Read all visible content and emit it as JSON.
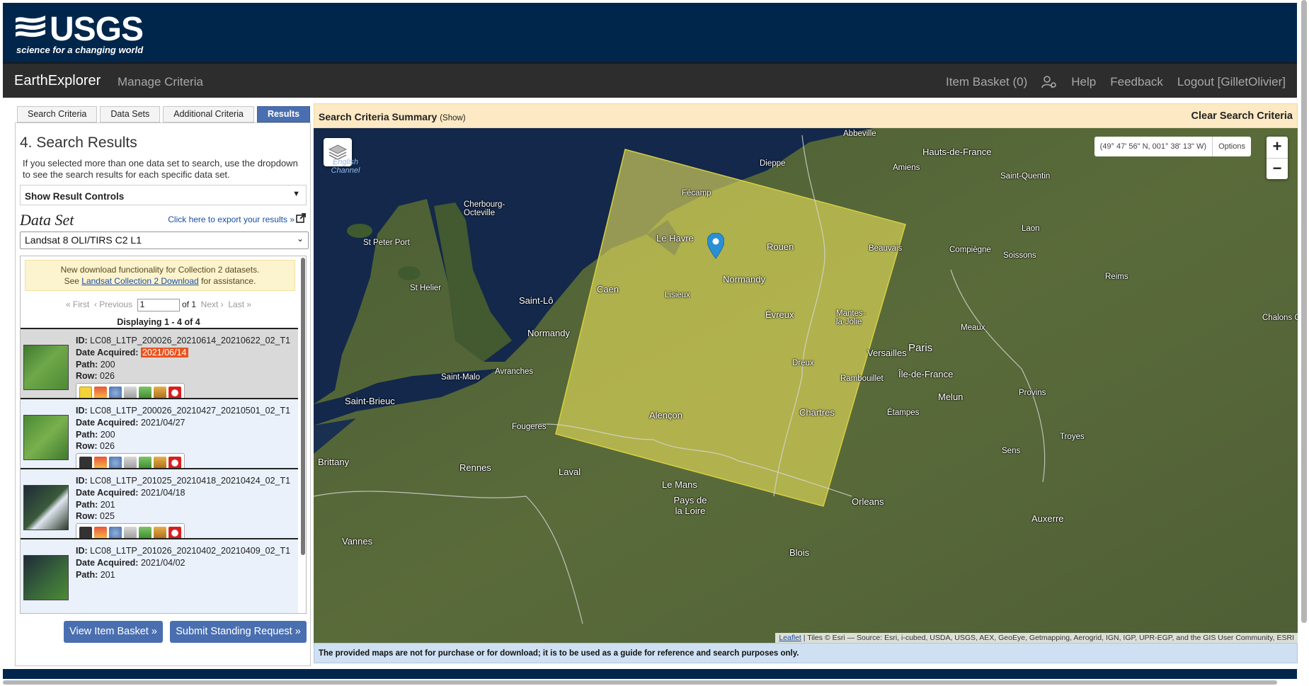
{
  "header": {
    "logo_text": "USGS",
    "logo_tagline": "science for a changing world"
  },
  "nav": {
    "brand": "EarthExplorer",
    "manage_criteria": "Manage Criteria",
    "item_basket": "Item Basket (0)",
    "help": "Help",
    "feedback": "Feedback",
    "logout": "Logout [GilletOlivier]"
  },
  "tabs": [
    "Search Criteria",
    "Data Sets",
    "Additional Criteria",
    "Results"
  ],
  "active_tab": "Results",
  "left": {
    "title": "4. Search Results",
    "help": "If you selected more than one data set to search, use the dropdown to see the search results for each specific data set.",
    "result_controls": "Show Result Controls",
    "dataset_label": "Data Set",
    "export_link": "Click here to export your results »",
    "dataset_selected": "Landsat 8 OLI/TIRS C2 L1",
    "notice_line1": "New download functionality for Collection 2 datasets.",
    "notice_see": "See",
    "notice_link": "Landsat Collection 2 Download",
    "notice_tail": "for assistance.",
    "pager": {
      "first": "« First",
      "previous": "‹ Previous",
      "page": "1",
      "of": "of 1",
      "next": "Next ›",
      "last": "Last »"
    },
    "displaying": "Displaying 1 - 4 of 4",
    "labels": {
      "id": "ID:",
      "date": "Date Acquired:",
      "path": "Path:",
      "row": "Row:"
    },
    "results": [
      {
        "id": "LC08_L1TP_200026_20210614_20210622_02_T1",
        "date": "2021/06/14",
        "path": "200",
        "row": "026"
      },
      {
        "id": "LC08_L1TP_200026_20210427_20210501_02_T1",
        "date": "2021/04/27",
        "path": "200",
        "row": "026"
      },
      {
        "id": "LC08_L1TP_201025_20210418_20210424_02_T1",
        "date": "2021/04/18",
        "path": "201",
        "row": "025"
      },
      {
        "id": "LC08_L1TP_201026_20210402_20210409_02_T1",
        "date": "2021/04/02",
        "path": "201",
        "row": ""
      }
    ],
    "tool_icons": [
      "footprint-icon",
      "overlay-icon",
      "metadata-icon",
      "compare-icon",
      "download-icon",
      "basket-icon",
      "exclude-icon"
    ],
    "view_basket": "View Item Basket »",
    "standing_request": "Submit Standing Request »"
  },
  "criteria": {
    "title": "Search Criteria Summary",
    "show": "(Show)",
    "clear": "Clear Search Criteria"
  },
  "map": {
    "coords": "(49° 47' 56\" N, 001° 38' 13\" W)",
    "options": "Options",
    "zoom_in": "+",
    "zoom_out": "−",
    "attribution_link": "Leaflet",
    "attribution": "| Tiles © Esri — Source: Esri, i-cubed, USDA, USGS, AEX, GeoEye, Getmapping, Aerogrid, IGN, IGP, UPR-EGP, and the GIS User Community, ESRI",
    "places": {
      "abbeville": "Abbeville",
      "hauts": "Hauts-de-France",
      "amiens": "Amiens",
      "stquentin": "Saint-Quentin",
      "dieppe": "Dieppe",
      "fecamp": "Fécamp",
      "lehavre": "Le Havre",
      "rouen": "Rouen",
      "beauvais": "Beauvais",
      "compiegne": "Compiègne",
      "laon": "Laon",
      "soissons": "Soissons",
      "reims": "Reims",
      "chalons": "Chalons Champa",
      "channel": "English Channel",
      "cherbourg": "Cherbourg-Octeville",
      "stpeter": "St Peter Port",
      "sthelier": "St Helier",
      "caen": "Caen",
      "lisieux": "Lisieux",
      "normandy1": "Normandy",
      "normandy2": "Normandy",
      "evreux": "Évreux",
      "mantes": "Mantes-la-Jolie",
      "meaux": "Meaux",
      "saintlo": "Saint-Lô",
      "versailles": "Versailles",
      "paris": "Paris",
      "iledefrance": "Île-de-France",
      "dreux": "Dreux",
      "rambouillet": "Rambouillet",
      "melun": "Melun",
      "provins": "Provins",
      "stmalo": "Saint-Malo",
      "avranches": "Avranches",
      "stbrieuc": "Saint-Brieuc",
      "alencon": "Alençon",
      "chartres": "Chartres",
      "etampes": "Étampes",
      "fougeres": "Fougeres",
      "troyes": "Troyes",
      "brittany": "Brittany",
      "rennes": "Rennes",
      "laval": "Laval",
      "sens": "Sens",
      "lemans": "Le Mans",
      "paysdeloire": "Pays de la Loire",
      "orleans": "Orleans",
      "auxerre": "Auxerre",
      "vannes": "Vannes",
      "blois": "Blois"
    }
  },
  "disclaimer": "The provided maps are not for purchase or for download; it is to be used as a guide for reference and search purposes only.",
  "colors": {
    "usgs_blue": "#00264c",
    "nav_dark": "#2d2d2d",
    "button_blue": "#4a6fb0",
    "footprint": "#e6df5a",
    "highlight": "#e8531f"
  }
}
